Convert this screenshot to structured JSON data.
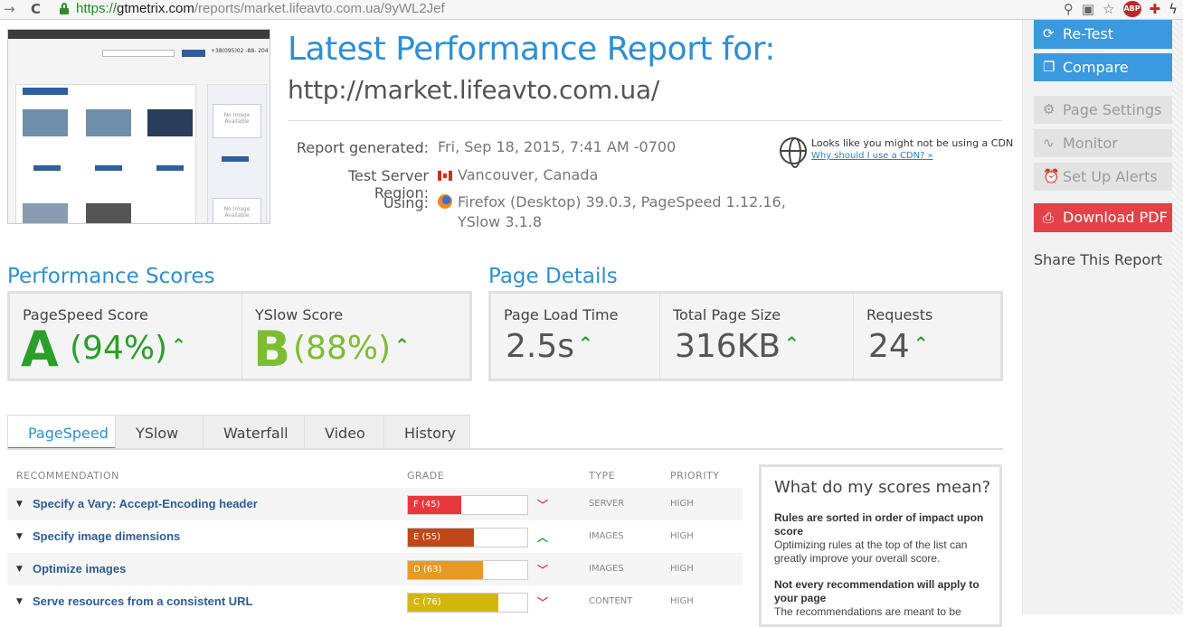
{
  "browser": {
    "url_scheme": "https://",
    "url_host": "gtmetrix.com",
    "url_path": "/reports/market.lifeavto.com.ua/9yWL2Jef",
    "abp_label": "ABP"
  },
  "header": {
    "title": "Latest Performance Report for:",
    "url": "http://market.lifeavto.com.ua/"
  },
  "report": {
    "generated_label": "Report generated:",
    "generated_value": "Fri, Sep 18, 2015, 7:41 AM -0700",
    "region_label": "Test Server Region:",
    "region_value": "Vancouver, Canada",
    "using_label": "Using:",
    "using_value_1": "Firefox (Desktop) 39.0.3, PageSpeed 1.12.16,",
    "using_value_2": "YSlow 3.1.8"
  },
  "cdn": {
    "notice": "Looks like you might not be using a CDN",
    "link": "Why should I use a CDN? »"
  },
  "sidebar": {
    "retest": "Re-Test",
    "compare": "Compare",
    "page_settings": "Page Settings",
    "monitor": "Monitor",
    "alerts": "Set Up Alerts",
    "download_pdf": "Download PDF",
    "share": "Share This Report"
  },
  "scores": {
    "heading": "Performance Scores",
    "pagespeed_label": "PageSpeed Score",
    "pagespeed_grade": "A",
    "pagespeed_pct": "(94%)",
    "yslow_label": "YSlow Score",
    "yslow_grade": "B",
    "yslow_pct": "(88%)",
    "colors": {
      "a": "#2aa02a",
      "b": "#7dbd32"
    }
  },
  "details": {
    "heading": "Page Details",
    "load_label": "Page Load Time",
    "load_value": "2.5s",
    "size_label": "Total Page Size",
    "size_value": "316KB",
    "req_label": "Requests",
    "req_value": "24"
  },
  "tabs": [
    "PageSpeed",
    "YSlow",
    "Waterfall",
    "Video",
    "History"
  ],
  "table": {
    "headers": {
      "recommendation": "RECOMMENDATION",
      "grade": "GRADE",
      "type": "TYPE",
      "priority": "PRIORITY"
    },
    "rows": [
      {
        "name": "Specify a Vary: Accept-Encoding header",
        "grade": "F (45)",
        "score": 45,
        "color": "#e8383d",
        "trend": "down",
        "type": "SERVER",
        "priority": "HIGH"
      },
      {
        "name": "Specify image dimensions",
        "grade": "E (55)",
        "score": 55,
        "color": "#c1471a",
        "trend": "up",
        "type": "IMAGES",
        "priority": "HIGH"
      },
      {
        "name": "Optimize images",
        "grade": "D (63)",
        "score": 63,
        "color": "#e59a26",
        "trend": "down",
        "type": "IMAGES",
        "priority": "HIGH"
      },
      {
        "name": "Serve resources from a consistent URL",
        "grade": "C (76)",
        "score": 76,
        "color": "#d3b80a",
        "trend": "down",
        "type": "CONTENT",
        "priority": "HIGH"
      }
    ]
  },
  "meaning": {
    "title": "What do my scores mean?",
    "b1": "Rules are sorted in order of impact upon score",
    "p1": "Optimizing rules at the top of the list can greatly improve your overall score.",
    "b2": "Not every recommendation will apply to your page",
    "p2": "The recommendations are meant to be"
  },
  "thumbnail": {
    "phone": "+38(095)02 -88- 204",
    "noimage": "No Image Available"
  }
}
